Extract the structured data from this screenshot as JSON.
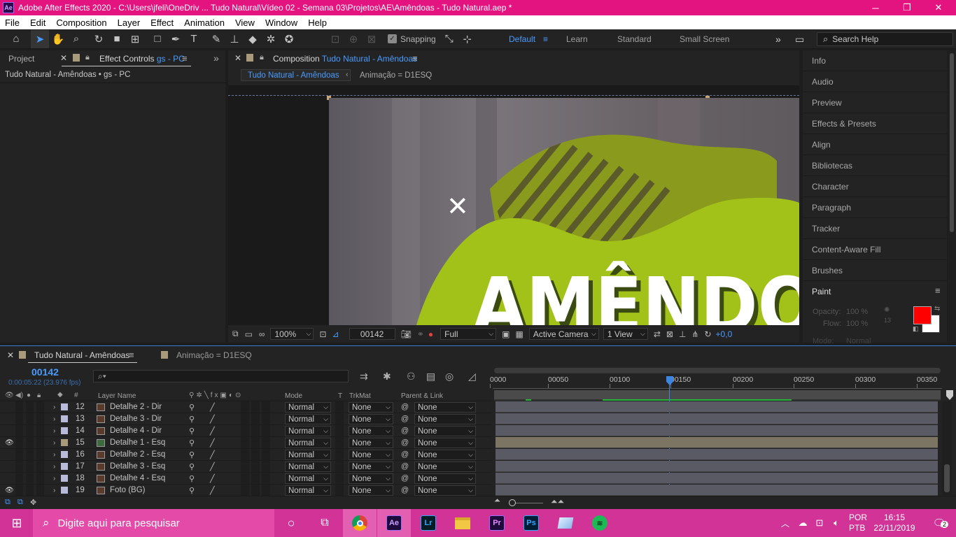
{
  "window": {
    "title": "Adobe After Effects 2020 - C:\\Users\\jfeli\\OneDriv ... Tudo Natural\\Vídeo 02 - Semana 03\\Projetos\\AE\\Amêndoas - Tudo Natural.aep *",
    "app_badge": "Ae"
  },
  "menu": [
    "File",
    "Edit",
    "Composition",
    "Layer",
    "Effect",
    "Animation",
    "View",
    "Window",
    "Help"
  ],
  "toolbar": {
    "snapping": "Snapping",
    "workspaces": [
      "Default",
      "Learn",
      "Standard",
      "Small Screen"
    ],
    "search_placeholder": "Search Help"
  },
  "left_panel": {
    "tab_project": "Project",
    "tab_effect": "Effect Controls",
    "effect_layer": "gs - PC",
    "subtitle": "Tudo Natural - Amêndoas • gs - PC"
  },
  "comp_panel": {
    "tab_prefix": "Composition",
    "comp_name": "Tudo Natural - Amêndoas",
    "breadcrumb_active": "Tudo Natural - Amêndoas",
    "breadcrumb_next": "Animação = D1ESQ",
    "viewer_text": "AMÊNDOAS",
    "viewer_mark": "✕"
  },
  "viewer_footer": {
    "zoom": "100%",
    "frame": "00142",
    "resolution": "Full",
    "camera": "Active Camera",
    "views": "1 View",
    "exposure": "+0,0"
  },
  "right_panel": {
    "items": [
      "Info",
      "Audio",
      "Preview",
      "Effects & Presets",
      "Align",
      "Bibliotecas",
      "Character",
      "Paragraph",
      "Tracker",
      "Content-Aware Fill",
      "Brushes",
      "Paint"
    ],
    "paint": {
      "opacity_label": "Opacity:",
      "opacity": "100 %",
      "flow_label": "Flow:",
      "flow": "100 %",
      "brush_size": "13",
      "mode_label": "Mode:",
      "mode": "Normal"
    },
    "fg_color": "#ff0000",
    "bg_color": "#ffffff"
  },
  "timeline": {
    "tab_active": "Tudo Natural - Amêndoas",
    "tab_other": "Animação = D1ESQ",
    "current_frame": "00142",
    "timecode": "0:00:05:22 (23.976 fps)",
    "search_placeholder": "",
    "col_layer_name": "Layer Name",
    "col_number": "#",
    "col_mode": "Mode",
    "col_t": "T",
    "col_trkmat": "TrkMat",
    "col_parent": "Parent & Link",
    "ruler": [
      "0000",
      "00050",
      "00100",
      "00150",
      "00200",
      "00250",
      "00300",
      "00350"
    ],
    "layers": [
      {
        "num": "12",
        "name": "Detalhe 2 - Dir",
        "mode": "Normal",
        "trkmat": "None",
        "parent": "None",
        "visible": false,
        "label_color": "#b9b9d9"
      },
      {
        "num": "13",
        "name": "Detalhe 3 - Dir",
        "mode": "Normal",
        "trkmat": "None",
        "parent": "None",
        "visible": false,
        "label_color": "#b9b9d9"
      },
      {
        "num": "14",
        "name": "Detalhe 4 - Dir",
        "mode": "Normal",
        "trkmat": "None",
        "parent": "None",
        "visible": false,
        "label_color": "#b9b9d9"
      },
      {
        "num": "15",
        "name": "Detalhe 1 - Esq",
        "mode": "Normal",
        "trkmat": "None",
        "parent": "None",
        "visible": true,
        "label_color": "#a89a7a"
      },
      {
        "num": "16",
        "name": "Detalhe 2 - Esq",
        "mode": "Normal",
        "trkmat": "None",
        "parent": "None",
        "visible": false,
        "label_color": "#b9b9d9"
      },
      {
        "num": "17",
        "name": "Detalhe 3 - Esq",
        "mode": "Normal",
        "trkmat": "None",
        "parent": "None",
        "visible": false,
        "label_color": "#b9b9d9"
      },
      {
        "num": "18",
        "name": "Detalhe 4 - Esq",
        "mode": "Normal",
        "trkmat": "None",
        "parent": "None",
        "visible": false,
        "label_color": "#b9b9d9"
      },
      {
        "num": "19",
        "name": "Foto (BG)",
        "mode": "Normal",
        "trkmat": "None",
        "parent": "None",
        "visible": true,
        "label_color": "#b9b9d9"
      }
    ]
  },
  "taskbar": {
    "search": "Digite aqui para pesquisar",
    "lang1": "POR",
    "lang2": "PTB",
    "time": "16:15",
    "date": "22/11/2019",
    "notifications": "2",
    "apps": [
      "Ae",
      "Lr",
      "Pr",
      "Ps"
    ]
  }
}
